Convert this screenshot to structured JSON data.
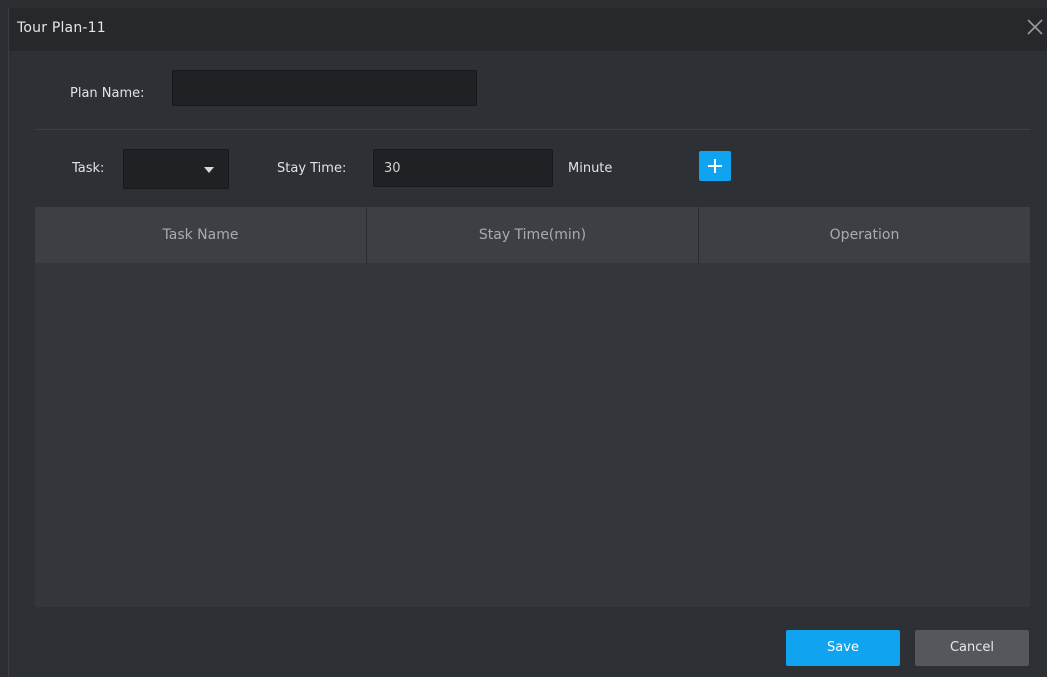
{
  "dialog": {
    "title": "Tour Plan-11"
  },
  "form": {
    "plan_name_label": "Plan Name:",
    "plan_name_value": "",
    "task_label": "Task:",
    "task_selected": "",
    "stay_time_label": "Stay Time:",
    "stay_time_value": "30",
    "stay_time_unit": "Minute"
  },
  "table": {
    "columns": [
      "Task Name",
      "Stay Time(min)",
      "Operation"
    ],
    "rows": []
  },
  "footer": {
    "save_label": "Save",
    "cancel_label": "Cancel"
  },
  "colors": {
    "accent": "#10a3ef",
    "background": "#2d3035",
    "titlebar": "#26282c",
    "table_header": "#3c3f44"
  },
  "icons": {
    "close": "close-icon",
    "dropdown": "caret-down-icon",
    "add": "plus-icon"
  }
}
